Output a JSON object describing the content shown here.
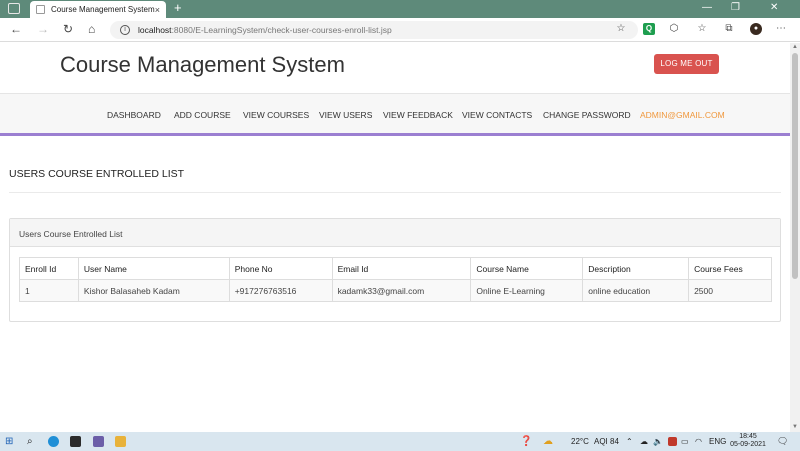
{
  "browser": {
    "tab_title": "Course Management System",
    "tab_close": "×",
    "new_tab": "+",
    "window_controls": [
      "—",
      "❐",
      "✕"
    ],
    "url_host": "localhost",
    "url_path": ":8080/E-LearningSystem/check-user-courses-enroll-list.jsp",
    "nav": {
      "back": "←",
      "forward": "→",
      "reload": "↻",
      "home": "⌂"
    }
  },
  "header": {
    "brand": "Course Management System",
    "logout_label": "LOG ME OUT"
  },
  "menu": {
    "items": [
      {
        "label": "DASHBOARD"
      },
      {
        "label": "ADD COURSE"
      },
      {
        "label": "VIEW COURSES"
      },
      {
        "label": "VIEW USERS"
      },
      {
        "label": "VIEW FEEDBACK"
      },
      {
        "label": "VIEW CONTACTS"
      },
      {
        "label": "CHANGE PASSWORD"
      },
      {
        "label": "ADMIN@GMAIL.COM"
      }
    ],
    "accent_color": "#9b7fd1",
    "active_color": "#f0983d"
  },
  "main": {
    "section_title": "USERS COURSE ENTROLLED LIST",
    "panel_title": "Users Course Entrolled List",
    "table": {
      "columns": [
        "Enroll Id",
        "User Name",
        "Phone No",
        "Email Id",
        "Course Name",
        "Description",
        "Course Fees"
      ],
      "rows": [
        [
          "1",
          "Kishor Balasaheb Kadam",
          "+917276763516",
          "kadamk33@gmail.com",
          "Online E-Learning",
          "online education",
          "2500"
        ]
      ]
    }
  },
  "taskbar": {
    "weather": "22°C",
    "aqi": "AQI 84",
    "lang": "ENG",
    "time": "18:45",
    "date": "05-09-2021"
  }
}
